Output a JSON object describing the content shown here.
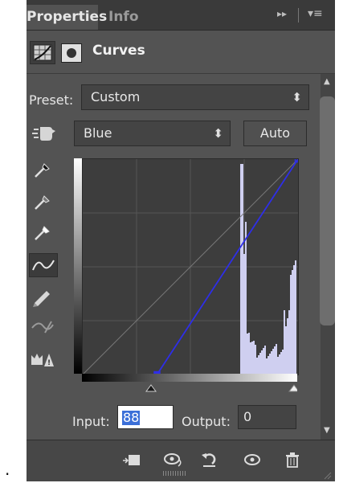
{
  "tabs": [
    {
      "label": "Properties"
    },
    {
      "label": "Info"
    }
  ],
  "header": {
    "collapse_glyph": "▸▸",
    "menu_glyph": "▾≡",
    "title": "Curves"
  },
  "preset": {
    "label": "Preset:",
    "value": "Custom"
  },
  "channel": {
    "value": "Blue"
  },
  "auto_button": {
    "label": "Auto"
  },
  "tools": [
    {
      "icon": "eyedropper-black-icon"
    },
    {
      "icon": "eyedropper-gray-icon"
    },
    {
      "icon": "eyedropper-white-icon"
    },
    {
      "icon": "curve-point-tool-icon",
      "active": true
    },
    {
      "icon": "pencil-icon"
    },
    {
      "icon": "smooth-curve-icon"
    },
    {
      "icon": "clipping-warning-icon"
    }
  ],
  "curve": {
    "channel_color": "#2e2ee8",
    "points": [
      {
        "input": 0,
        "output": 0
      },
      {
        "input": 88,
        "output": 0
      },
      {
        "input": 255,
        "output": 255
      }
    ],
    "histogram_color": "#cfcff0"
  },
  "io": {
    "input_label": "Input:",
    "input_value": "88",
    "output_label": "Output:",
    "output_value": "0"
  },
  "stray_text": ".",
  "colors": {
    "panel_bg": "#535353",
    "accent": "#2e2ee8"
  }
}
